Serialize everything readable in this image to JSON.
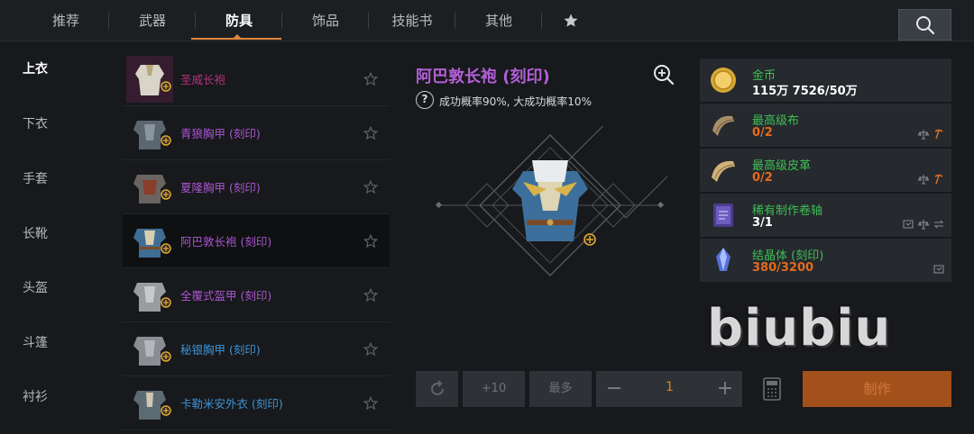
{
  "tabs": [
    {
      "label": "推荐"
    },
    {
      "label": "武器"
    },
    {
      "label": "防具"
    },
    {
      "label": "饰品"
    },
    {
      "label": "技能书"
    },
    {
      "label": "其他"
    }
  ],
  "categories": [
    {
      "label": "上衣"
    },
    {
      "label": "下衣"
    },
    {
      "label": "手套"
    },
    {
      "label": "长靴"
    },
    {
      "label": "头盔"
    },
    {
      "label": "斗篷"
    },
    {
      "label": "衬衫"
    }
  ],
  "items": [
    {
      "name": "圣威长袍",
      "color": "#b2307e"
    },
    {
      "name": "青狼胸甲 (刻印)",
      "color": "#a955cf"
    },
    {
      "name": "夏隆胸甲 (刻印)",
      "color": "#a955cf"
    },
    {
      "name": "阿巴敦长袍 (刻印)",
      "color": "#a955cf"
    },
    {
      "name": "全覆式盔甲 (刻印)",
      "color": "#a955cf"
    },
    {
      "name": "秘银胸甲 (刻印)",
      "color": "#3d93d6"
    },
    {
      "name": "卡勒米安外衣 (刻印)",
      "color": "#3d93d6"
    }
  ],
  "detail": {
    "title": "阿巴敦长袍 (刻印)",
    "question_mark": "?",
    "rate_text": "成功概率90%, 大成功概率10%"
  },
  "materials": [
    {
      "name": "金币",
      "count": "115万 7526/50万",
      "count_color": "#ffffff",
      "icon": "gold-coin-icon"
    },
    {
      "name": "最高级布",
      "count": "0/2",
      "count_color": "#e36b1e",
      "icon": "cloth-icon"
    },
    {
      "name": "最高级皮革",
      "count": "0/2",
      "count_color": "#e36b1e",
      "icon": "leather-icon"
    },
    {
      "name": "稀有制作卷轴",
      "count": "3/1",
      "count_color": "#ffffff",
      "icon": "scroll-icon"
    },
    {
      "name": "结晶体 (刻印)",
      "count": "380/3200",
      "count_color": "#e36b1e",
      "icon": "crystal-icon"
    }
  ],
  "watermark": "biubiu",
  "controls": {
    "plus10": "+10",
    "max": "最多",
    "minus": "−",
    "plus": "+",
    "quantity": "1",
    "craft": "制作"
  },
  "colors": {
    "accent": "#e2863a",
    "epic_purple": "#a955cf",
    "rare_blue": "#3d93d6",
    "material_green": "#3fbf56",
    "deficit_orange": "#e36b1e"
  }
}
